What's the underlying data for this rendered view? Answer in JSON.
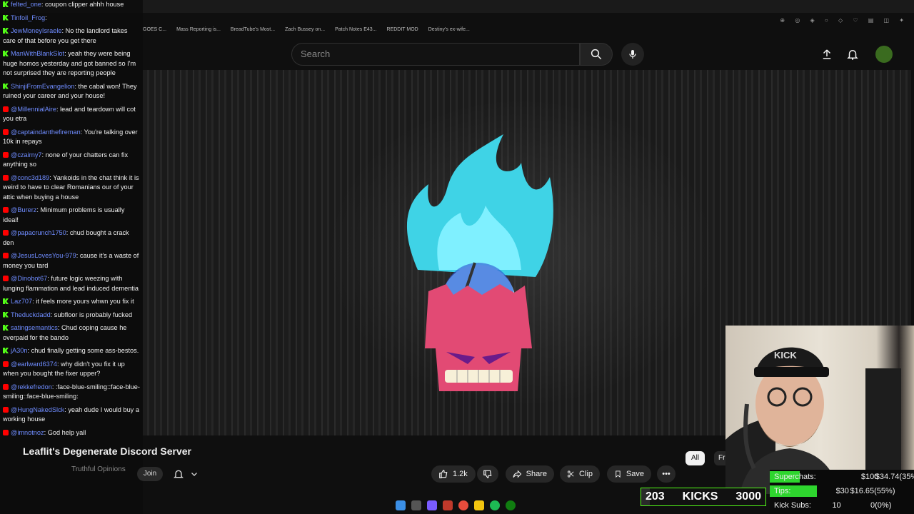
{
  "bookmarks": [
    "GOES C...",
    "Mass Reporting is...",
    "BreadTube's Most...",
    "Zach Bussey on...",
    "Patch Notes E43...",
    "REDDIT MOD",
    "Destiny's ex-wife..."
  ],
  "search": {
    "placeholder": "Search"
  },
  "chat": [
    {
      "badge": "kick",
      "user": "felted_one",
      "text": "coupon clipper ahhh house"
    },
    {
      "badge": "kick",
      "user": "Tinfoil_Frog",
      "text": ""
    },
    {
      "badge": "kick",
      "user": "JewMoneyIsraele",
      "text": "No the landlord takes care of that before you get there"
    },
    {
      "badge": "kick",
      "user": "ManWithBlankSlot",
      "text": "yeah they were being huge homos yesterday and got banned so I'm not surprised they are reporting people"
    },
    {
      "badge": "kick",
      "user": "ShinjiFromEvangelion",
      "text": "the cabal won! They ruined your career and your house!"
    },
    {
      "badge": "yt",
      "user": "@MillennialAire",
      "text": "lead and teardown will cot you etra"
    },
    {
      "badge": "yt",
      "user": "@captaindanthefireman",
      "text": "You're talking over 10k in repays"
    },
    {
      "badge": "yt",
      "user": "@czairny7",
      "text": "none of your chatters can fix anything so"
    },
    {
      "badge": "yt",
      "user": "@conc3d189",
      "text": "Yankoids in the chat think it is weird to have to clear Romanians our of your attic when buying a house"
    },
    {
      "badge": "yt",
      "user": "@Burerz",
      "text": "Minimum problems is usually ideal!"
    },
    {
      "badge": "yt",
      "user": "@papacrunch1750",
      "text": "chud bought a crack den"
    },
    {
      "badge": "yt",
      "user": "@JesusLovesYou-979",
      "text": "cause it's a waste of money you tard"
    },
    {
      "badge": "yt",
      "user": "@Dinobot67",
      "text": "future logic weezing with lunging flammation and lead induced dementia"
    },
    {
      "badge": "kick",
      "user": "Laz707",
      "text": "it feels more yours whwn you fix it"
    },
    {
      "badge": "kick",
      "user": "Theduckdadd",
      "text": "subfloor is probably fucked"
    },
    {
      "badge": "kick",
      "user": "satingsemantics",
      "text": "Chud coping cause he overpaid for the bando"
    },
    {
      "badge": "kick",
      "user": "jA30n",
      "text": "chud finally getting some ass-bestos."
    },
    {
      "badge": "yt",
      "user": "@earlward6374",
      "text": "why didn't you fix it up when you bought the fixer upper?"
    },
    {
      "badge": "yt",
      "user": "@rekkefredon",
      "text": ":face-blue-smiling::face-blue-smiling::face-blue-smiling:"
    },
    {
      "badge": "yt",
      "user": "@HungNakedSlck",
      "text": "yeah dude I would buy a working house"
    },
    {
      "badge": "yt",
      "user": "@imnotnoz",
      "text": "God help yall"
    }
  ],
  "video": {
    "title": "Leaflit's Degenerate Discord Server",
    "channel": "Truthful Opinions"
  },
  "actions": {
    "join": "Join",
    "likes": "1.2k",
    "share": "Share",
    "clip": "Clip",
    "save": "Save"
  },
  "chips": {
    "all": "All",
    "fr": "Fr"
  },
  "stats": {
    "superchats_label": "Superchats:",
    "superchats_amount": "$34.74(35%)",
    "superchats_goal": "$100",
    "superchats_pct": 35,
    "tips_label": "Tips:",
    "tips_amount": "$16.65(55%)",
    "tips_goal": "$30",
    "tips_pct": 55,
    "subs_label": "Kick Subs:",
    "subs_amount": "0(0%)",
    "subs_goal": "10"
  },
  "kicks": {
    "current": "203",
    "label": "KICKS",
    "goal": "3000"
  },
  "colors": {
    "kick_green": "#53fc18",
    "yt_red": "#ff0000",
    "username_blue": "#6f8cff"
  }
}
